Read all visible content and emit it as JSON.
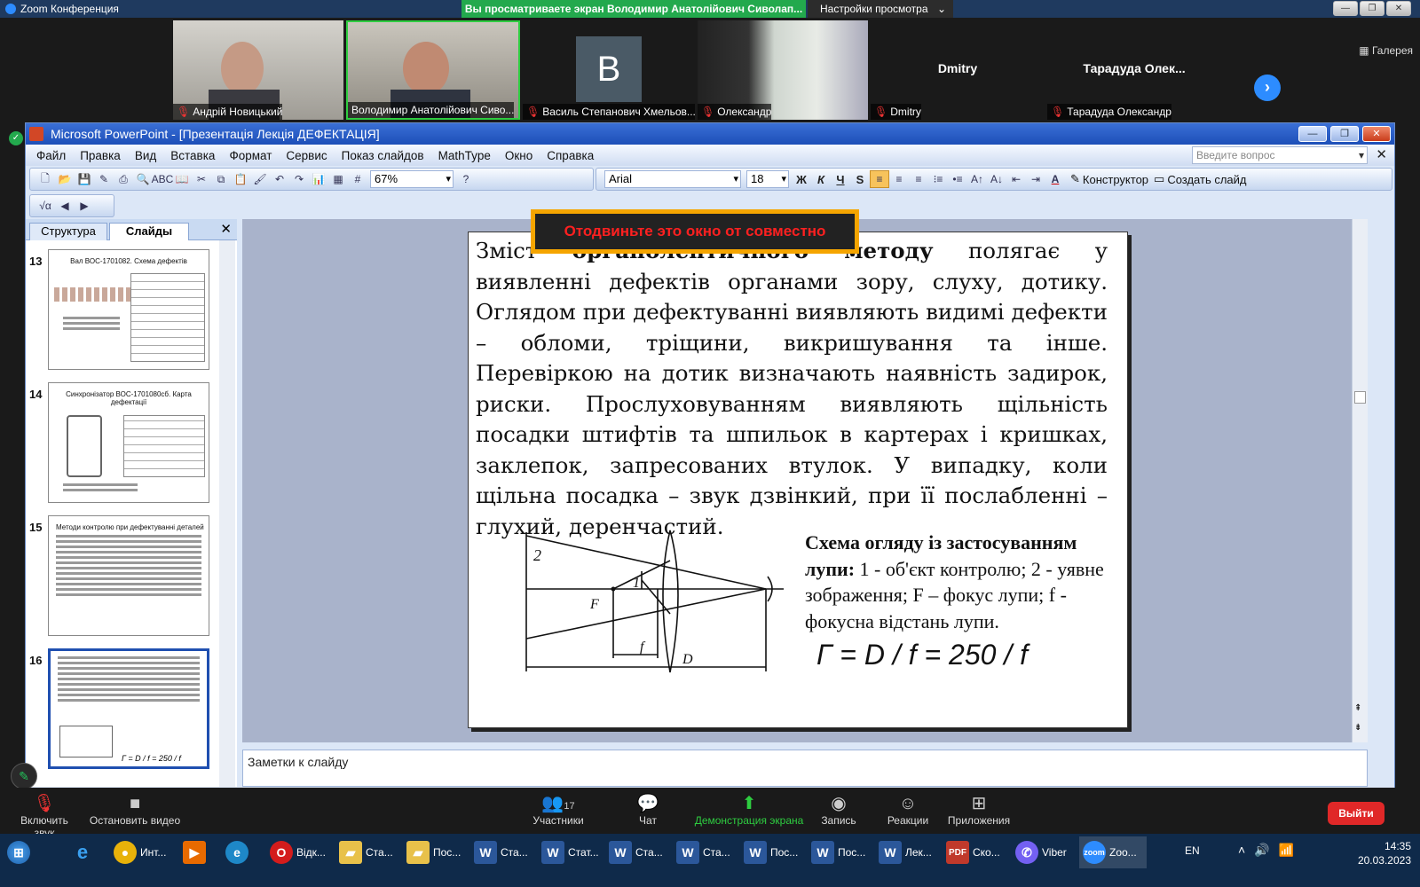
{
  "zoom": {
    "window_title": "Zoom Конференция",
    "share_banner": "Вы просматриваете экран Володимир Анатолійович Сиволап...",
    "view_settings": "Настройки просмотра",
    "gallery_label": "Галерея",
    "participants": [
      {
        "name": "Андрій Новицький",
        "tile_color": "#c9c7c2"
      },
      {
        "name": "Володимир Анатолійович Сиво...",
        "tile_color": "#b8b5ae"
      },
      {
        "name": "Василь Степанович Хмельов...",
        "initial": "B"
      },
      {
        "name": "Олександр",
        "tile_color": "#d8ddd6"
      },
      {
        "name": "Dmitry",
        "center": "Dmitry"
      },
      {
        "name": "Тарадуда Олександр",
        "center": "Тарадуда  Олек..."
      }
    ],
    "bottom": {
      "unmute": "Включить звук",
      "stop_video": "Остановить видео",
      "participants": "Участники",
      "participants_count": "17",
      "chat": "Чат",
      "share": "Демонстрация экрана",
      "record": "Запись",
      "reactions": "Реакции",
      "apps": "Приложения",
      "exit": "Выйти"
    }
  },
  "ppt": {
    "title": "Microsoft PowerPoint - [Презентація  Лекція ДЕФЕКТАЦІЯ]",
    "menu": [
      "Файл",
      "Правка",
      "Вид",
      "Вставка",
      "Формат",
      "Сервис",
      "Показ слайдов",
      "MathType",
      "Окно",
      "Справка"
    ],
    "ask_placeholder": "Введите вопрос",
    "zoom_level": "67%",
    "font_name": "Arial",
    "font_size": "18",
    "format_buttons": [
      "Ж",
      "К",
      "Ч",
      "S"
    ],
    "designer": "Конструктор",
    "new_slide": "Создать слайд",
    "tabs": [
      "Структура",
      "Слайды"
    ],
    "thumbnails": [
      {
        "num": "13",
        "title": "Вал ВОС-1701082. Схема дефектів"
      },
      {
        "num": "14",
        "title": "Синхронізатор ВОС-1701080сб. Карта дефектації"
      },
      {
        "num": "15",
        "title": "Методи контролю при дефектуванні деталей"
      },
      {
        "num": "16",
        "title": "Зміст органолептичного методу"
      }
    ],
    "slide": {
      "paragraph_lead": "Зміст ",
      "paragraph_bold": "органолептичного методу",
      "paragraph_rest": " полягає у виявленні дефектів органами зору, слуху, дотику. Оглядом при дефектуванні виявляють видимі дефекти – обломи, тріщини, викришування та інше. Перевіркою на дотик визначають наявність задирок, риски. Прослуховуванням виявляють щільність посадки штифтів та шпильок в картерах і кришках, заклепок, запресованих втулок. У випадку, коли щільна посадка – звук дзвінкий, при її послабленні – глухий, деренчастий.",
      "caption_bold": "Схема огляду із застосуванням лупи:",
      "caption_rest": " 1 - об'єкт контролю; 2 - уявне зображення; F – фокус лупи; f - фокусна відстань лупи.",
      "formula": "Г = D / f = 250 / f",
      "diagram_labels": {
        "l1": "1",
        "l2": "2",
        "F": "F",
        "f": "f",
        "D": "D"
      }
    },
    "share_warning": "Отодвиньте это окно от совместно",
    "notes_placeholder": "Заметки к слайду"
  },
  "taskbar": {
    "items": [
      {
        "label": "Инт...",
        "color": "#e8b20a"
      },
      {
        "label": "",
        "color": "#e86a00"
      },
      {
        "label": "",
        "color": "#1e88c8"
      },
      {
        "label": "Відк...",
        "color": "#d41c1c"
      },
      {
        "label": "Ста...",
        "color": "#e8c14a"
      },
      {
        "label": "Пос...",
        "color": "#e8c14a"
      },
      {
        "label": "Ста...",
        "color": "#2b579a"
      },
      {
        "label": "Стат...",
        "color": "#2b579a"
      },
      {
        "label": "Ста...",
        "color": "#2b579a"
      },
      {
        "label": "Ста...",
        "color": "#2b579a"
      },
      {
        "label": "Пос...",
        "color": "#2b579a"
      },
      {
        "label": "Пос...",
        "color": "#2b579a"
      },
      {
        "label": "Лек...",
        "color": "#2b579a"
      },
      {
        "label": "Ско...",
        "color": "#c0392b"
      },
      {
        "label": "Viber",
        "color": "#7360f2"
      },
      {
        "label": "Zoo...",
        "color": "#2d8cff"
      }
    ],
    "lang": "EN",
    "time": "14:35",
    "date": "20.03.2023"
  }
}
